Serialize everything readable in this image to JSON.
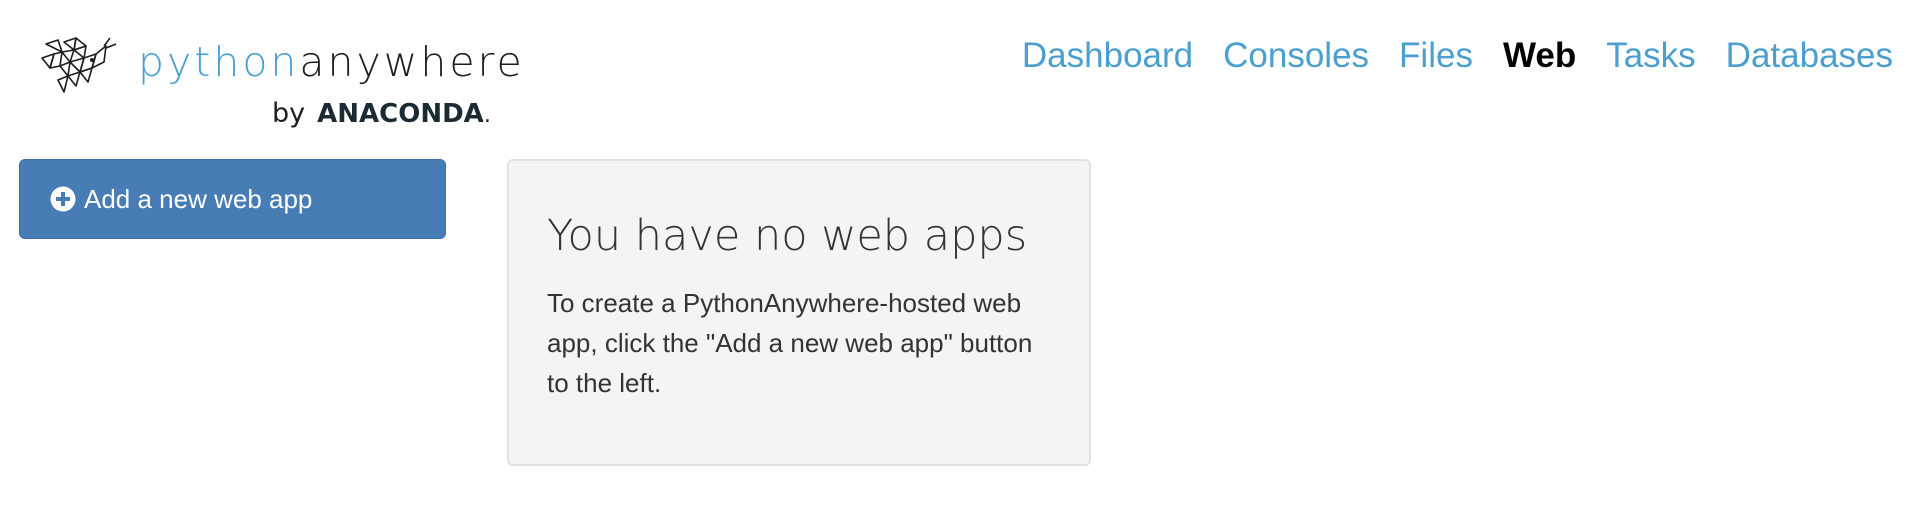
{
  "brand": {
    "word_first": "python",
    "word_second": "anywhere",
    "by": "by",
    "company": "ANACONDA",
    "company_dot": ".",
    "colors": {
      "python": "#4a9fd0",
      "anywhere": "#1e1e1e",
      "anaconda": "#1a2b33"
    },
    "icon": "pythonanywhere-logo-icon"
  },
  "nav": {
    "items": [
      {
        "label": "Dashboard",
        "active": false
      },
      {
        "label": "Consoles",
        "active": false
      },
      {
        "label": "Files",
        "active": false
      },
      {
        "label": "Web",
        "active": true
      },
      {
        "label": "Tasks",
        "active": false
      },
      {
        "label": "Databases",
        "active": false
      }
    ],
    "link_color": "#4a9fd0",
    "active_color": "#000000"
  },
  "sidebar": {
    "add_button": {
      "label": "Add a new web app",
      "icon": "plus-circle-icon",
      "color": "#477cb5"
    }
  },
  "main": {
    "empty_title": "You have no web apps",
    "empty_body": "To create a PythonAnywhere-hosted web app, click the \"Add a new web app\" button to the left.",
    "panel_color": "#f4f4f4"
  }
}
